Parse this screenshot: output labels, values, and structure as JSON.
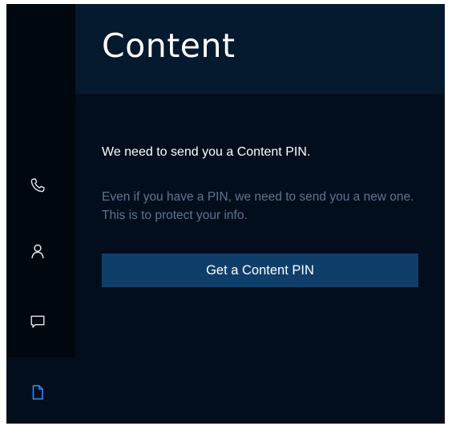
{
  "header": {
    "title": "Content"
  },
  "sidebar": {
    "items": [
      {
        "name": "calls",
        "icon": "phone-icon",
        "selected": false
      },
      {
        "name": "people",
        "icon": "person-icon",
        "selected": false
      },
      {
        "name": "messages",
        "icon": "chat-icon",
        "selected": false
      },
      {
        "name": "content",
        "icon": "document-icon",
        "selected": true
      }
    ]
  },
  "main": {
    "heading": "We need to send you a Content PIN.",
    "description": "Even if you have a PIN, we need to send you a new one. This is to protect your info.",
    "button_label": "Get a Content PIN"
  },
  "colors": {
    "background": "#030e1c",
    "header": "#05192f",
    "rail": "#01070f",
    "accent": "#2f8cff",
    "button": "#0f3e6b",
    "secondary_text": "#5d7590"
  }
}
